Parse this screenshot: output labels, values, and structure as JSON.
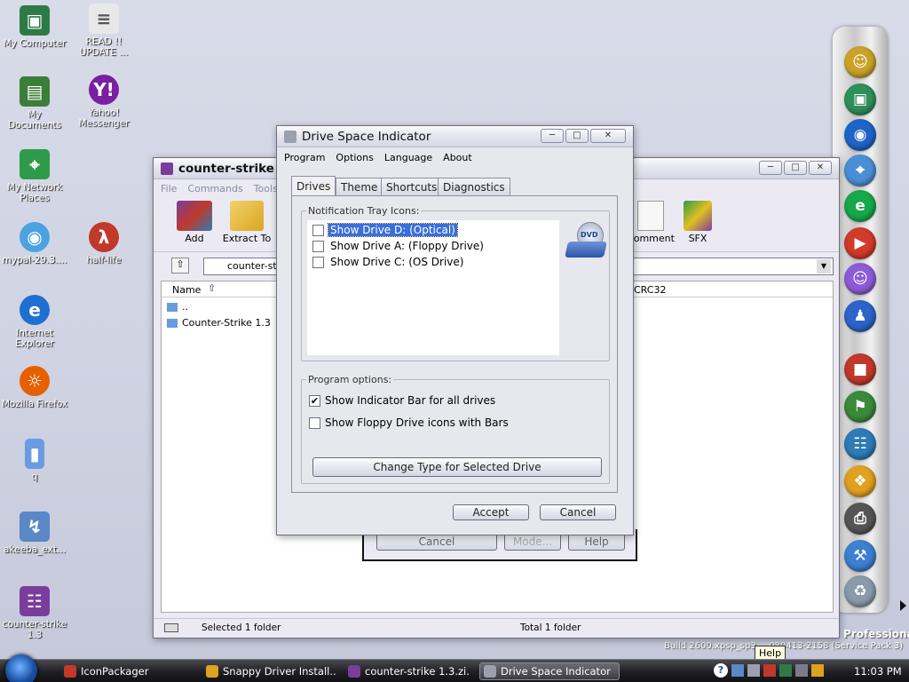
{
  "desktop": {
    "icons": [
      {
        "label": "My Computer",
        "icon": "computer-icon",
        "color": "#2e7a46"
      },
      {
        "label": "READ !! UPDATE ...",
        "icon": "text-document-icon",
        "color": "#e8e8e8"
      },
      {
        "label": "My Documents",
        "icon": "documents-folder-icon",
        "color": "#3d7d3a"
      },
      {
        "label": "Yahoo! Messenger",
        "icon": "yahoo-messenger-icon",
        "color": "#7b1fa2"
      },
      {
        "label": "My Network Places",
        "icon": "network-icon",
        "color": "#2f9a4a"
      },
      {
        "label": "half-life",
        "icon": "half-life-icon",
        "color": "#c0392b"
      },
      {
        "label": "mypal-29.3....",
        "icon": "setup-disc-icon",
        "color": "#4aa3df"
      },
      {
        "label": "Internet Explorer",
        "icon": "internet-explorer-icon",
        "color": "#1e6fd0"
      },
      {
        "label": "Mozilla Firefox",
        "icon": "firefox-icon",
        "color": "#e66000"
      },
      {
        "label": "q",
        "icon": "folder-icon",
        "color": "#6a9be0"
      },
      {
        "label": "akeeba_ext...",
        "icon": "installer-icon",
        "color": "#5a87c5"
      },
      {
        "label": "counter-strike 1.3",
        "icon": "winrar-archive-icon",
        "color": "#7a3d9c"
      }
    ],
    "watermark": {
      "edition": "Professional",
      "build": "Build 2600.xpsp_sp3_...080413-2158 (Service Pack 3)"
    },
    "help_tooltip": "Help"
  },
  "dock": {
    "items": [
      {
        "icon": "smiley-app-icon",
        "color": "#c9a227"
      },
      {
        "icon": "monitor-app-icon",
        "color": "#2f8f5a"
      },
      {
        "icon": "globe-app-icon",
        "color": "#1e64c8"
      },
      {
        "icon": "network-app-icon",
        "color": "#4a8fd6"
      },
      {
        "icon": "ie-app-icon",
        "color": "#17a84a"
      },
      {
        "icon": "media-app-icon",
        "color": "#d23a2a"
      },
      {
        "icon": "messenger-app-icon",
        "color": "#8c5bd6"
      },
      {
        "icon": "msn-user-app-icon",
        "color": "#2c64c8"
      },
      {
        "icon": "cube-app-icon",
        "color": "#c0392b"
      },
      {
        "icon": "windows-flag-icon",
        "color": "#3a8a3a"
      },
      {
        "icon": "books-app-icon",
        "color": "#2e7bb6"
      },
      {
        "icon": "windows-logo-app-icon",
        "color": "#e0a020"
      },
      {
        "icon": "scanner-app-icon",
        "color": "#555555"
      },
      {
        "icon": "tools-app-icon",
        "color": "#3d7fd0"
      },
      {
        "icon": "recycle-bin-icon",
        "color": "#8a9aa8"
      }
    ]
  },
  "winrar": {
    "title": "counter-strike 1.3",
    "menu": [
      "File",
      "Commands",
      "Tools"
    ],
    "toolbar": [
      "Add",
      "Extract To",
      "Comment",
      "SFX"
    ],
    "address": "counter-strik",
    "columns": [
      "Name",
      "CRC32"
    ],
    "rows": [
      "..",
      "Counter-Strike 1.3"
    ],
    "status_left": "Selected 1 folder",
    "status_right": "Total 1 folder",
    "behind_buttons": [
      "Cancel",
      "Mode...",
      "Help"
    ]
  },
  "dialog": {
    "title": "Drive Space Indicator",
    "menu": [
      "Program",
      "Options",
      "Language",
      "About"
    ],
    "tabs": [
      "Drives",
      "Theme",
      "Shortcuts",
      "Diagnostics"
    ],
    "tray_group_label": "Notification Tray Icons:",
    "drives": [
      {
        "label": "Show Drive D: (Optical)",
        "checked": false,
        "selected": true
      },
      {
        "label": "Show Drive A: (Floppy Drive)",
        "checked": false,
        "selected": false
      },
      {
        "label": "Show Drive C: (OS Drive)",
        "checked": false,
        "selected": false
      }
    ],
    "drive_badge": "DVD",
    "program_options_label": "Program options:",
    "options": [
      {
        "label": "Show Indicator Bar for all drives",
        "checked": true
      },
      {
        "label": "Show Floppy Drive icons with Bars",
        "checked": false
      }
    ],
    "change_type_button": "Change Type for Selected Drive",
    "accept_button": "Accept",
    "cancel_button": "Cancel"
  },
  "taskbar": {
    "items": [
      {
        "label": "IconPackager",
        "color": "#c0392b",
        "active": false
      },
      {
        "label": "Snappy Driver Install...",
        "color": "#e0a020",
        "active": false
      },
      {
        "label": "counter-strike 1.3.zi...",
        "color": "#7a3d9c",
        "active": false
      },
      {
        "label": "Drive Space Indicator",
        "color": "#9aa0ad",
        "active": true
      }
    ],
    "clock": "11:03 PM"
  }
}
